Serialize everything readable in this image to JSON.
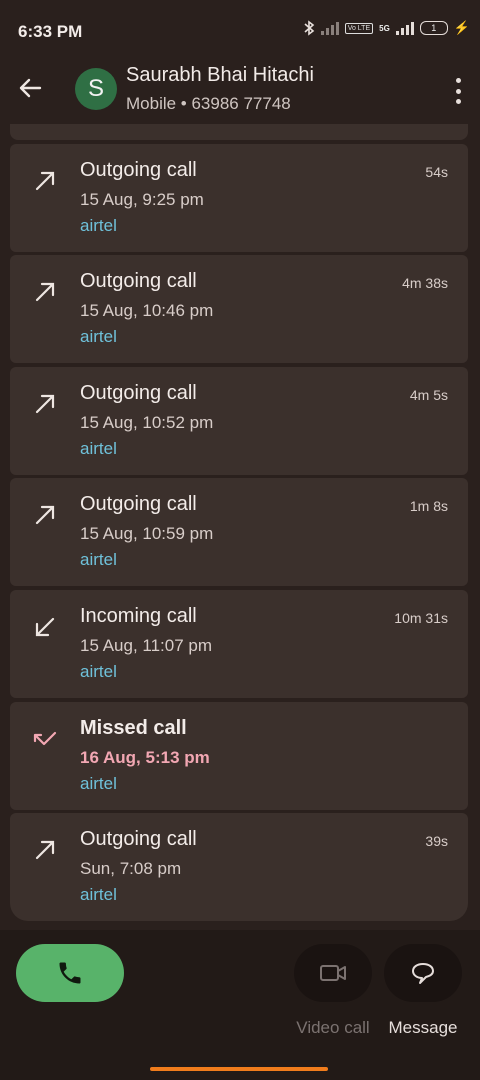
{
  "status_bar": {
    "time": "6:33 PM",
    "network_5g": "5G",
    "volte_tag": "Vo LTE",
    "battery_level": "1",
    "icons": [
      "bluetooth-icon",
      "signal-icon",
      "volte-icon",
      "signal-5g-icon",
      "battery-icon",
      "charging-icon"
    ]
  },
  "header": {
    "back_icon": "arrow-back-icon",
    "avatar_letter": "S",
    "avatar_color": "#2f6f44",
    "contact_name": "Saurabh Bhai Hitachi",
    "contact_detail": "Mobile • 63986 77748",
    "menu_icon": "more-vert-icon"
  },
  "calls": [
    {
      "type": "Outgoing call",
      "datetime": "15 Aug, 9:25 pm",
      "network": "airtel",
      "duration": "54s",
      "direction": "outgoing"
    },
    {
      "type": "Outgoing call",
      "datetime": "15 Aug, 10:46 pm",
      "network": "airtel",
      "duration": "4m 38s",
      "direction": "outgoing"
    },
    {
      "type": "Outgoing call",
      "datetime": "15 Aug, 10:52 pm",
      "network": "airtel",
      "duration": "4m 5s",
      "direction": "outgoing"
    },
    {
      "type": "Outgoing call",
      "datetime": "15 Aug, 10:59 pm",
      "network": "airtel",
      "duration": "1m 8s",
      "direction": "outgoing"
    },
    {
      "type": "Incoming call",
      "datetime": "15 Aug, 11:07 pm",
      "network": "airtel",
      "duration": "10m 31s",
      "direction": "incoming"
    },
    {
      "type": "Missed call",
      "datetime": "16 Aug, 5:13 pm",
      "network": "airtel",
      "duration": "",
      "direction": "missed"
    },
    {
      "type": "Outgoing call",
      "datetime": "Sun, 7:08 pm",
      "network": "airtel",
      "duration": "39s",
      "direction": "outgoing"
    }
  ],
  "actions": {
    "call_icon": "phone-icon",
    "video_call_label": "Video call",
    "video_icon": "videocam-icon",
    "message_label": "Message",
    "message_icon": "message-bubble-icon"
  },
  "colors": {
    "background": "#2a201d",
    "card": "#3b302c",
    "network_text": "#6fc1da",
    "missed_text": "#f2a7b3",
    "call_button": "#58b36a",
    "nav_handle": "#f07c1c"
  }
}
